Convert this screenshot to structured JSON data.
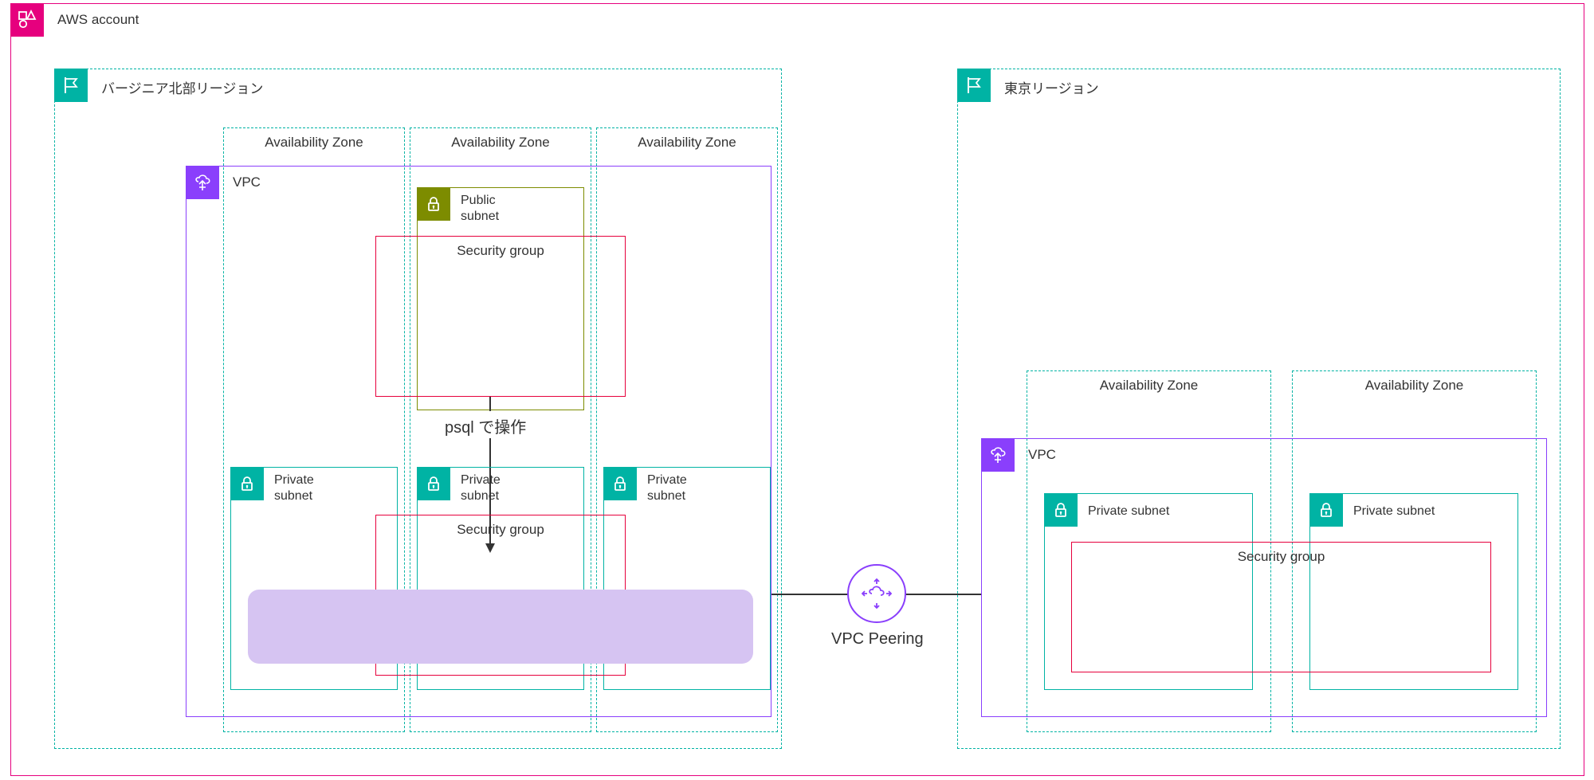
{
  "account_label": "AWS account",
  "region_left": "バージニア北部リージョン",
  "region_right": "東京リージョン",
  "az_label": "Availability Zone",
  "vpc_label": "VPC",
  "public_subnet": "Public\nsubnet",
  "private_subnet_short": "Private\nsubnet",
  "private_subnet_long": "Private subnet",
  "security_group": "Security group",
  "psql_text": "psql で操作",
  "vpc_peering": "VPC Peering"
}
